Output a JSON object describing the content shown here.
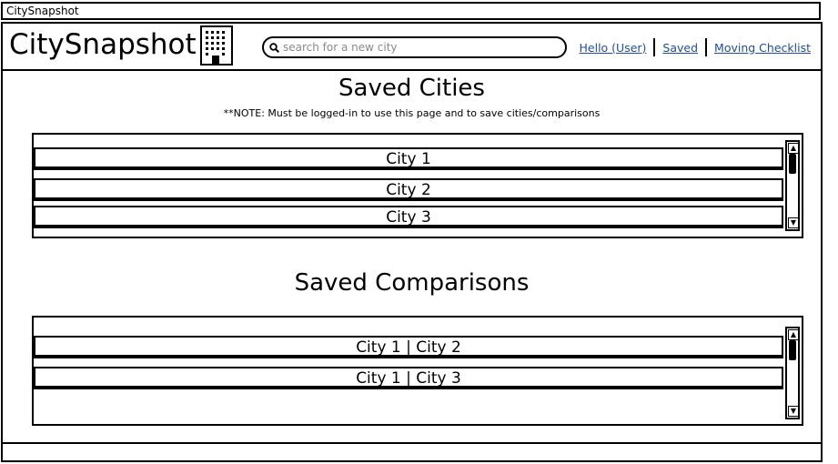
{
  "window": {
    "title": "CitySnapshot"
  },
  "header": {
    "logo": "CitySnapshot",
    "search_placeholder": "search for a new city",
    "nav": {
      "hello": "Hello (User)",
      "saved": "Saved",
      "checklist": "Moving Checklist"
    }
  },
  "saved_cities": {
    "title": "Saved Cities",
    "note": "**NOTE: Must be logged-in to use this page and to save cities/comparisons",
    "items": [
      "City 1",
      "City 2",
      "City 3"
    ]
  },
  "saved_comparisons": {
    "title": "Saved Comparisons",
    "items": [
      "City 1 | City 2",
      "City 1 | City 3"
    ]
  },
  "icons": {
    "logo": "building-icon",
    "search": "search-icon"
  }
}
